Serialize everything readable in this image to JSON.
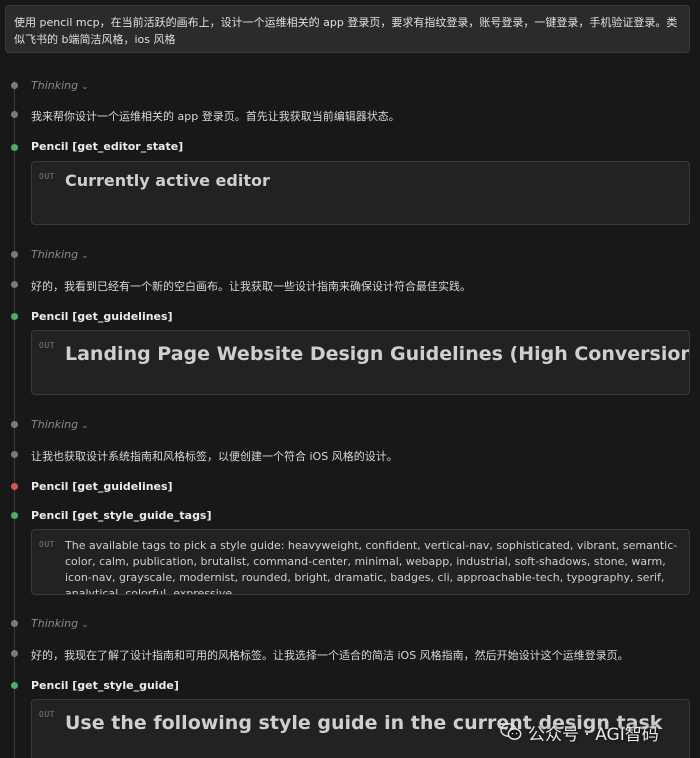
{
  "prompt": "使用 pencil mcp，在当前活跃的画布上，设计一个运维相关的 app 登录页，要求有指纹登录，账号登录，一键登录，手机验证登录。类似飞书的 b端简洁风格，ios 风格",
  "thinking_label": "Thinking",
  "out_label": "OUT",
  "steps": {
    "think1": "Thinking",
    "msg1": "我来帮你设计一个运维相关的 app 登录页。首先让我获取当前编辑器状态。",
    "tool1": "Pencil [get_editor_state]",
    "out1": "Currently active editor",
    "think2": "Thinking",
    "msg2": "好的，我看到已经有一个新的空白画布。让我获取一些设计指南来确保设计符合最佳实践。",
    "tool2": "Pencil [get_guidelines]",
    "out2": "Landing Page Website Design Guidelines (High Conversion + High Craft)",
    "think3": "Thinking",
    "msg3": "让我也获取设计系统指南和风格标签，以便创建一个符合 iOS 风格的设计。",
    "tool3": "Pencil [get_guidelines]",
    "tool4": "Pencil [get_style_guide_tags]",
    "out4": "The available tags to pick a style guide: heavyweight, confident, vertical-nav, sophisticated, vibrant, semantic-color, calm, publication, brutalist, command-center, minimal, webapp, industrial, soft-shadows, stone, warm, icon-nav, grayscale, modernist, rounded, bright, dramatic, badges, cli, approachable-tech, typography, serif, analytical, colorful, expressive,",
    "think4": "Thinking",
    "msg4": "好的，我现在了解了设计指南和可用的风格标签。让我选择一个适合的简洁 iOS 风格指南，然后开始设计这个运维登录页。",
    "tool5": "Pencil [get_style_guide]",
    "out5": "Use the following style guide in the current design task"
  },
  "watermark": "公众号 · AGI智码",
  "colors": {
    "background": "#181818",
    "dot_default": "#7a7a7a",
    "dot_success": "#4caf68",
    "dot_error": "#d9534f"
  }
}
